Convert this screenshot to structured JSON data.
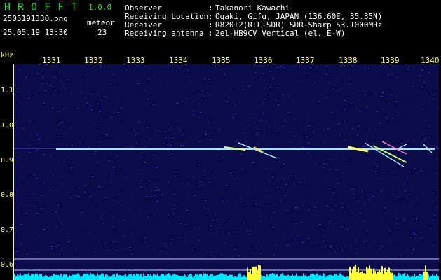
{
  "app": {
    "name": "HROFFT",
    "version": "1.0.0"
  },
  "file": "2505191330.png",
  "datetime": "25.05.19 13:30",
  "meteor": {
    "label": "meteor",
    "count": "23"
  },
  "info": [
    {
      "label": "Observer",
      "value": "Takanori Kawachi"
    },
    {
      "label": "Receiving Location",
      "value": "Ogaki, Gifu, JAPAN (136.60E, 35.35N)"
    },
    {
      "label": "Receiver",
      "value": "R820T2(RTL-SDR) SDR-Sharp 53.1000MHz"
    },
    {
      "label": "Receiving antenna",
      "value": "2el-HB9CV Vertical (el. E-W)"
    }
  ],
  "x_ticks": [
    "1331",
    "1332",
    "1333",
    "1334",
    "1335",
    "1336",
    "1337",
    "1338",
    "1339",
    "1340"
  ],
  "y_unit": "kHz",
  "y_ticks": [
    "1.1",
    "1.0",
    "0.9",
    "0.8",
    "0.7",
    "0.6"
  ],
  "colors": {
    "background": "#0b0b4a",
    "accent": "#ffff66",
    "title": "#22dd22",
    "echo": "#e6ff88",
    "noise_floor": "#00e5ff"
  }
}
